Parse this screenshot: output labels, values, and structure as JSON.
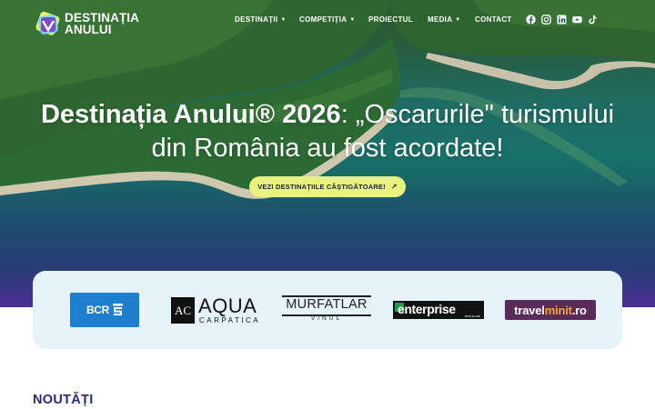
{
  "header": {
    "logo_line1": "DESTINAȚIA",
    "logo_line2": "ANULUI",
    "menu": [
      {
        "label": "DESTINAȚII",
        "has_dropdown": true
      },
      {
        "label": "COMPETIȚIA",
        "has_dropdown": true
      },
      {
        "label": "PROIECTUL",
        "has_dropdown": false
      },
      {
        "label": "MEDIA",
        "has_dropdown": true
      },
      {
        "label": "CONTACT",
        "has_dropdown": false
      }
    ],
    "social_icons": [
      "facebook-icon",
      "instagram-icon",
      "linkedin-icon",
      "youtube-icon",
      "tiktok-icon"
    ]
  },
  "hero": {
    "title_bold": "Destinația Anului® 2026",
    "title_rest": ": „Oscarurile\" turismului din România au fost acordate!",
    "cta_label": "VEZI DESTINAȚIILE CÂȘTIGĂTOARE!",
    "cta_icon": "arrow-up-right-icon"
  },
  "sponsors": {
    "bcr": "BCR",
    "aqua_main": "AQUA",
    "aqua_sub": "CARPATICA",
    "aqua_mark": "AC",
    "murfatlar_main": "MURFATLAR",
    "murfatlar_sub": "VINUL",
    "enterprise_main": "enterprise",
    "enterprise_sub": "rent-a-car",
    "travelminit_a": "travel",
    "travelminit_b": "minit",
    "travelminit_c": ".ro"
  },
  "section": {
    "news_title": "NOUTĂȚI"
  },
  "colors": {
    "cta_bg": "#e7f27f",
    "sponsor_band": "#e6f3fb",
    "news_title": "#2a2a7a",
    "bcr_blue": "#1e7fce",
    "travelminit_purple": "#5a2a5a"
  }
}
